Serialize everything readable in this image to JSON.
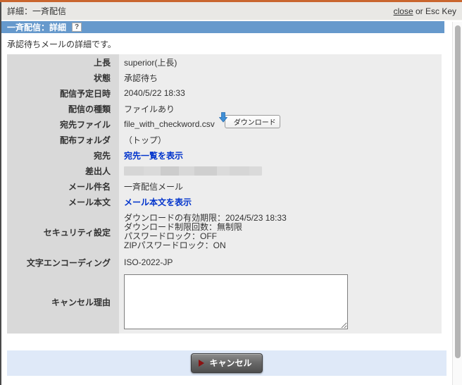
{
  "colors": {
    "accent_orange": "#c9662e",
    "header_blue": "#6699cc",
    "link_blue": "#0033cc",
    "footer_blue": "#dfe9f8",
    "label_column_gray": "#d9d9d9",
    "value_column_gray": "#ededed",
    "button_triangle_red": "#8b1111"
  },
  "window": {
    "title": "詳細：一斉配信",
    "close_link": "close",
    "close_hint": " or Esc Key"
  },
  "panel": {
    "title": "一斉配信：詳細",
    "help_icon": "?"
  },
  "intro": "承認待ちメールの詳細です。",
  "fields": {
    "superior": {
      "label": "上長",
      "value": "superior(上長)"
    },
    "status": {
      "label": "状態",
      "value": "承認待ち"
    },
    "scheduled_datetime": {
      "label": "配信予定日時",
      "value": "2040/5/22 18:33"
    },
    "delivery_type": {
      "label": "配信の種類",
      "value": "ファイルあり"
    },
    "recipient_file": {
      "label": "宛先ファイル",
      "filename": "file_with_checkword.csv",
      "download_button": "ダウンロード"
    },
    "distribution_folder": {
      "label": "配布フォルダ",
      "value": "（トップ）"
    },
    "recipients": {
      "label": "宛先",
      "link": "宛先一覧を表示"
    },
    "sender": {
      "label": "差出人"
    },
    "subject": {
      "label": "メール件名",
      "value": "一斉配信メール"
    },
    "mail_body": {
      "label": "メール本文",
      "link": "メール本文を表示"
    },
    "security": {
      "label": "セキュリティ設定",
      "lines": [
        "ダウンロードの有効期限：2024/5/23 18:33",
        "ダウンロード制限回数：無制限",
        "パスワードロック：OFF",
        "ZIPパスワードロック：ON"
      ]
    },
    "encoding": {
      "label": "文字エンコーディング",
      "value": "ISO-2022-JP"
    },
    "cancel_reason": {
      "label": "キャンセル理由",
      "value": ""
    }
  },
  "footer": {
    "cancel_button": "キャンセル"
  }
}
